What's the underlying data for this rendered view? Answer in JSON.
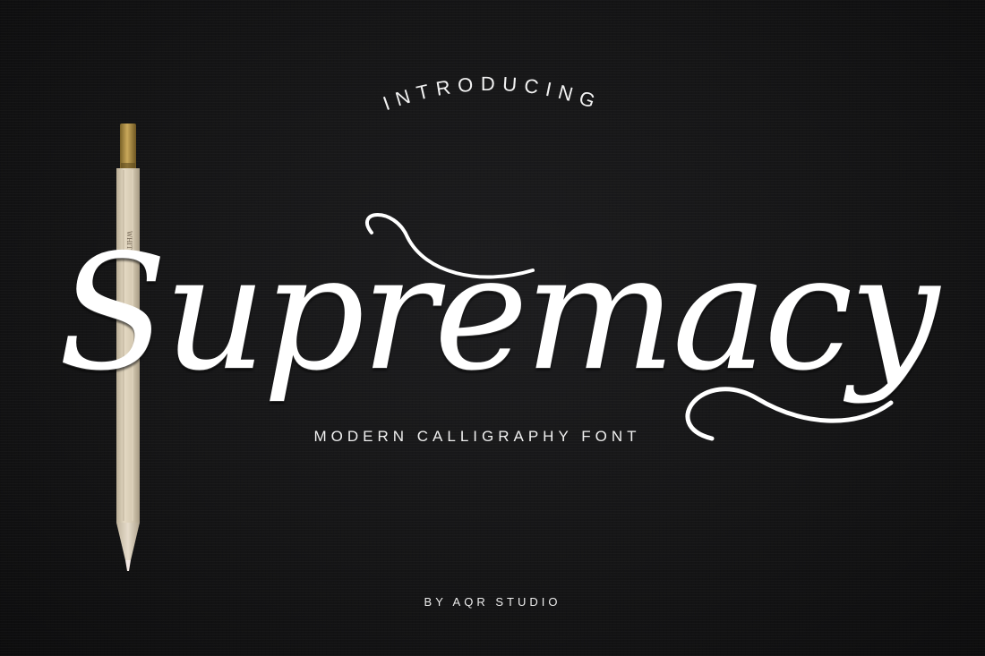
{
  "poster": {
    "intro": "INTRODUCING",
    "title": "Supremacy",
    "subtitle": "MODERN CALLIGRAPHY FONT",
    "byline": "BY AQR STUDIO"
  },
  "pencil": {
    "imprint": "WHITE"
  },
  "colors": {
    "background": "#131314",
    "text": "#ffffff",
    "pencil_body": "#d8ccb4",
    "pencil_ferrule": "#b08f45",
    "pencil_tip": "#f3e9e5"
  }
}
